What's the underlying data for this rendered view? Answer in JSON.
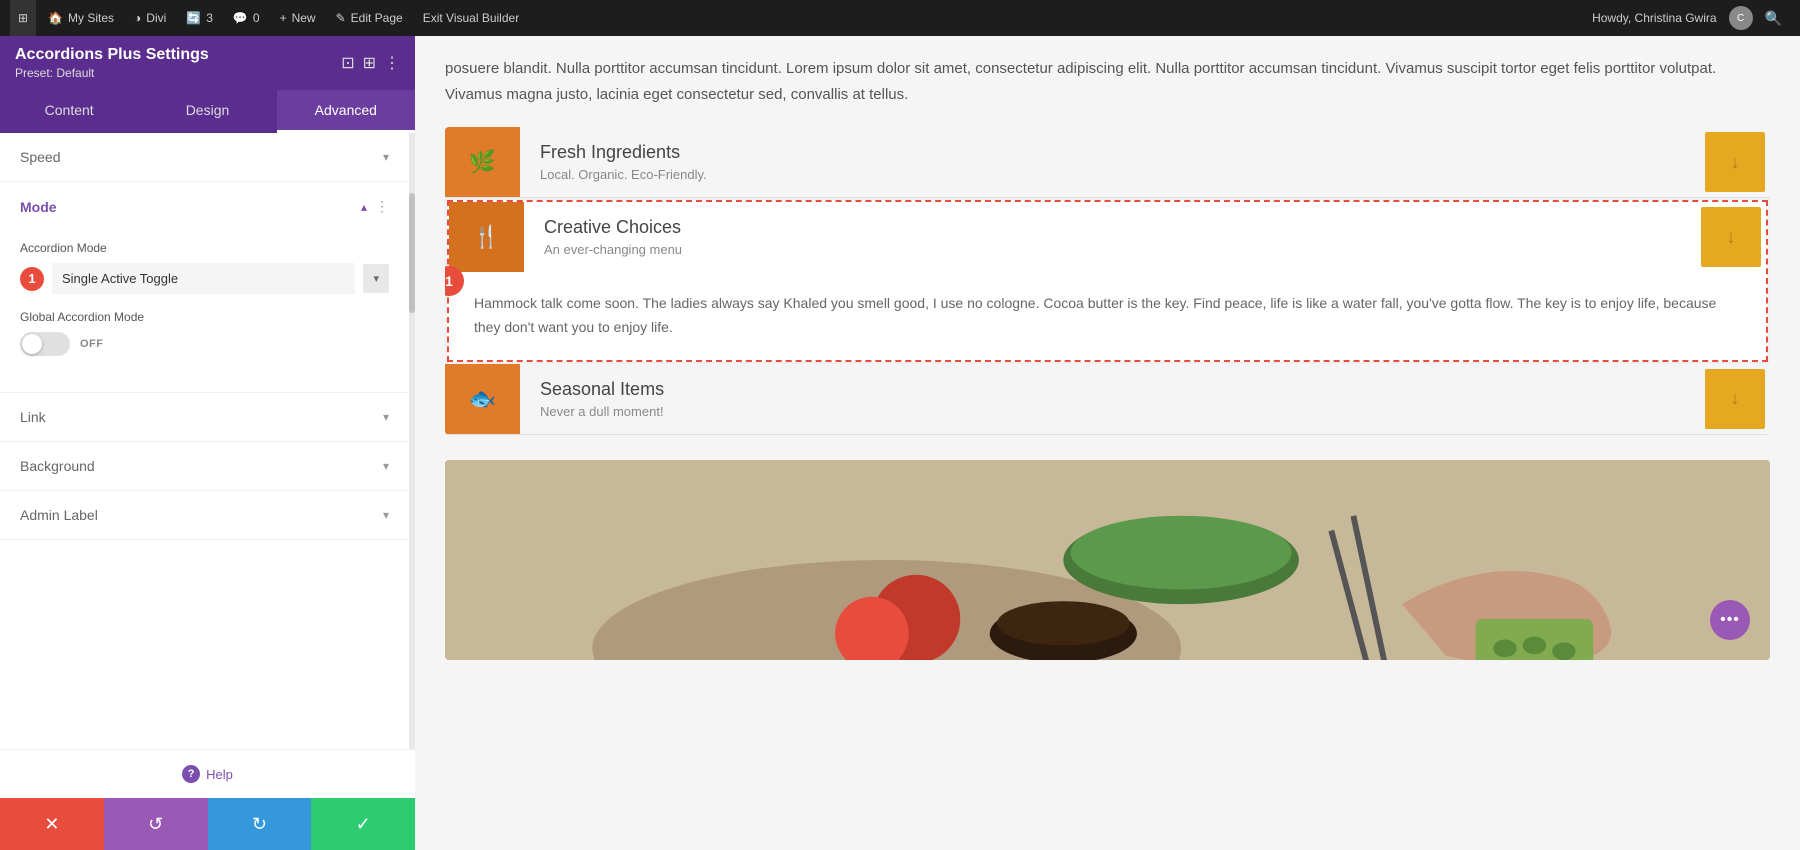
{
  "adminBar": {
    "wpIcon": "⊞",
    "items": [
      {
        "label": "My Sites",
        "icon": "🏠"
      },
      {
        "label": "Divi",
        "icon": "◑"
      },
      {
        "label": "3",
        "icon": "🔄"
      },
      {
        "label": "0",
        "icon": "💬"
      },
      {
        "label": "New",
        "icon": "+"
      },
      {
        "label": "Edit Page",
        "icon": "✎"
      },
      {
        "label": "Exit Visual Builder",
        "icon": ""
      }
    ],
    "userLabel": "Howdy, Christina Gwira",
    "searchIcon": "🔍"
  },
  "panel": {
    "title": "Accordions Plus Settings",
    "preset": "Preset: Default",
    "tabs": [
      "Content",
      "Design",
      "Advanced"
    ],
    "activeTab": "Content"
  },
  "sections": {
    "speed": {
      "label": "Speed",
      "expanded": false
    },
    "mode": {
      "label": "Mode",
      "expanded": true,
      "accordionMode": {
        "label": "Accordion Mode",
        "value": "Single Active Toggle",
        "badge": "1"
      },
      "globalAccordionMode": {
        "label": "Global Accordion Mode",
        "toggleState": "OFF"
      }
    },
    "link": {
      "label": "Link",
      "expanded": false
    },
    "background": {
      "label": "Background",
      "expanded": false
    },
    "adminLabel": {
      "label": "Admin Label",
      "expanded": false
    }
  },
  "help": {
    "label": "Help"
  },
  "actions": {
    "cancel": "✕",
    "undo": "↺",
    "redo": "↻",
    "save": "✓"
  },
  "content": {
    "bodyText": "posuere blandit. Nulla porttitor accumsan tincidunt. Lorem ipsum dolor sit amet, consectetur adipiscing elit. Nulla porttitor accumsan tincidunt. Vivamus suscipit tortor eget felis porttitor volutpat. Vivamus magna justo, lacinia eget consectetur sed, convallis at tellus.",
    "accordions": [
      {
        "id": 1,
        "icon": "🌿",
        "title": "Fresh Ingredients",
        "subtitle": "Local. Organic. Eco-Friendly.",
        "active": false,
        "badge": null
      },
      {
        "id": 2,
        "icon": "🍴",
        "title": "Creative Choices",
        "subtitle": "An ever-changing menu",
        "active": true,
        "badge": "1",
        "body": "Hammock talk come soon. The ladies always say Khaled you smell good, I use no cologne. Cocoa butter is the key. Find peace, life is like a water fall, you've gotta flow. The key is to enjoy life, because they don't want you to enjoy life."
      },
      {
        "id": 3,
        "icon": "🐟",
        "title": "Seasonal Items",
        "subtitle": "Never a dull moment!",
        "active": false,
        "badge": null
      }
    ],
    "dotsBtn": "•••"
  }
}
